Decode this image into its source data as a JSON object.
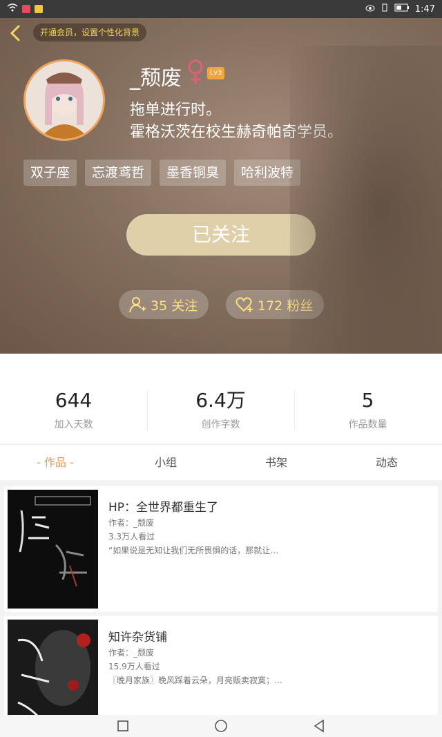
{
  "status_bar": {
    "time": "1:47"
  },
  "header": {
    "vip_banner": "开通会员，设置个性化背景",
    "username": "_颓废",
    "level": "Lv3",
    "bio_line1": "拖单进行时。",
    "bio_line2": "霍格沃茨在校生赫奇帕奇学员。",
    "tags": [
      "双子座",
      "忘渡鸢哲",
      "墨香铜臭",
      "哈利波特"
    ],
    "follow_button": "已关注",
    "following_count": "35 关注",
    "fans_count": "172 粉丝"
  },
  "stats": [
    {
      "value": "644",
      "label": "加入天数"
    },
    {
      "value": "6.4万",
      "label": "创作字数"
    },
    {
      "value": "5",
      "label": "作品数量"
    }
  ],
  "tabs": [
    "- 作品 -",
    "小组",
    "书架",
    "动态"
  ],
  "works": [
    {
      "title": "HP：全世界都重生了",
      "author": "作者：_颓废",
      "views": "3.3万人看过",
      "desc": "“如果说是无知让我们无所畏惧的话，那就让…"
    },
    {
      "title": "知许杂货铺",
      "author": "作者：_颓废",
      "views": "15.9万人看过",
      "desc": "〖晚月家族〗晚风踩着云朵，月亮贩卖寂寞；…"
    }
  ],
  "colors": {
    "accent": "#e39a53",
    "gold": "#ffe082",
    "follow_button": "#dfd0a9",
    "level_badge": "#f1a63b"
  }
}
